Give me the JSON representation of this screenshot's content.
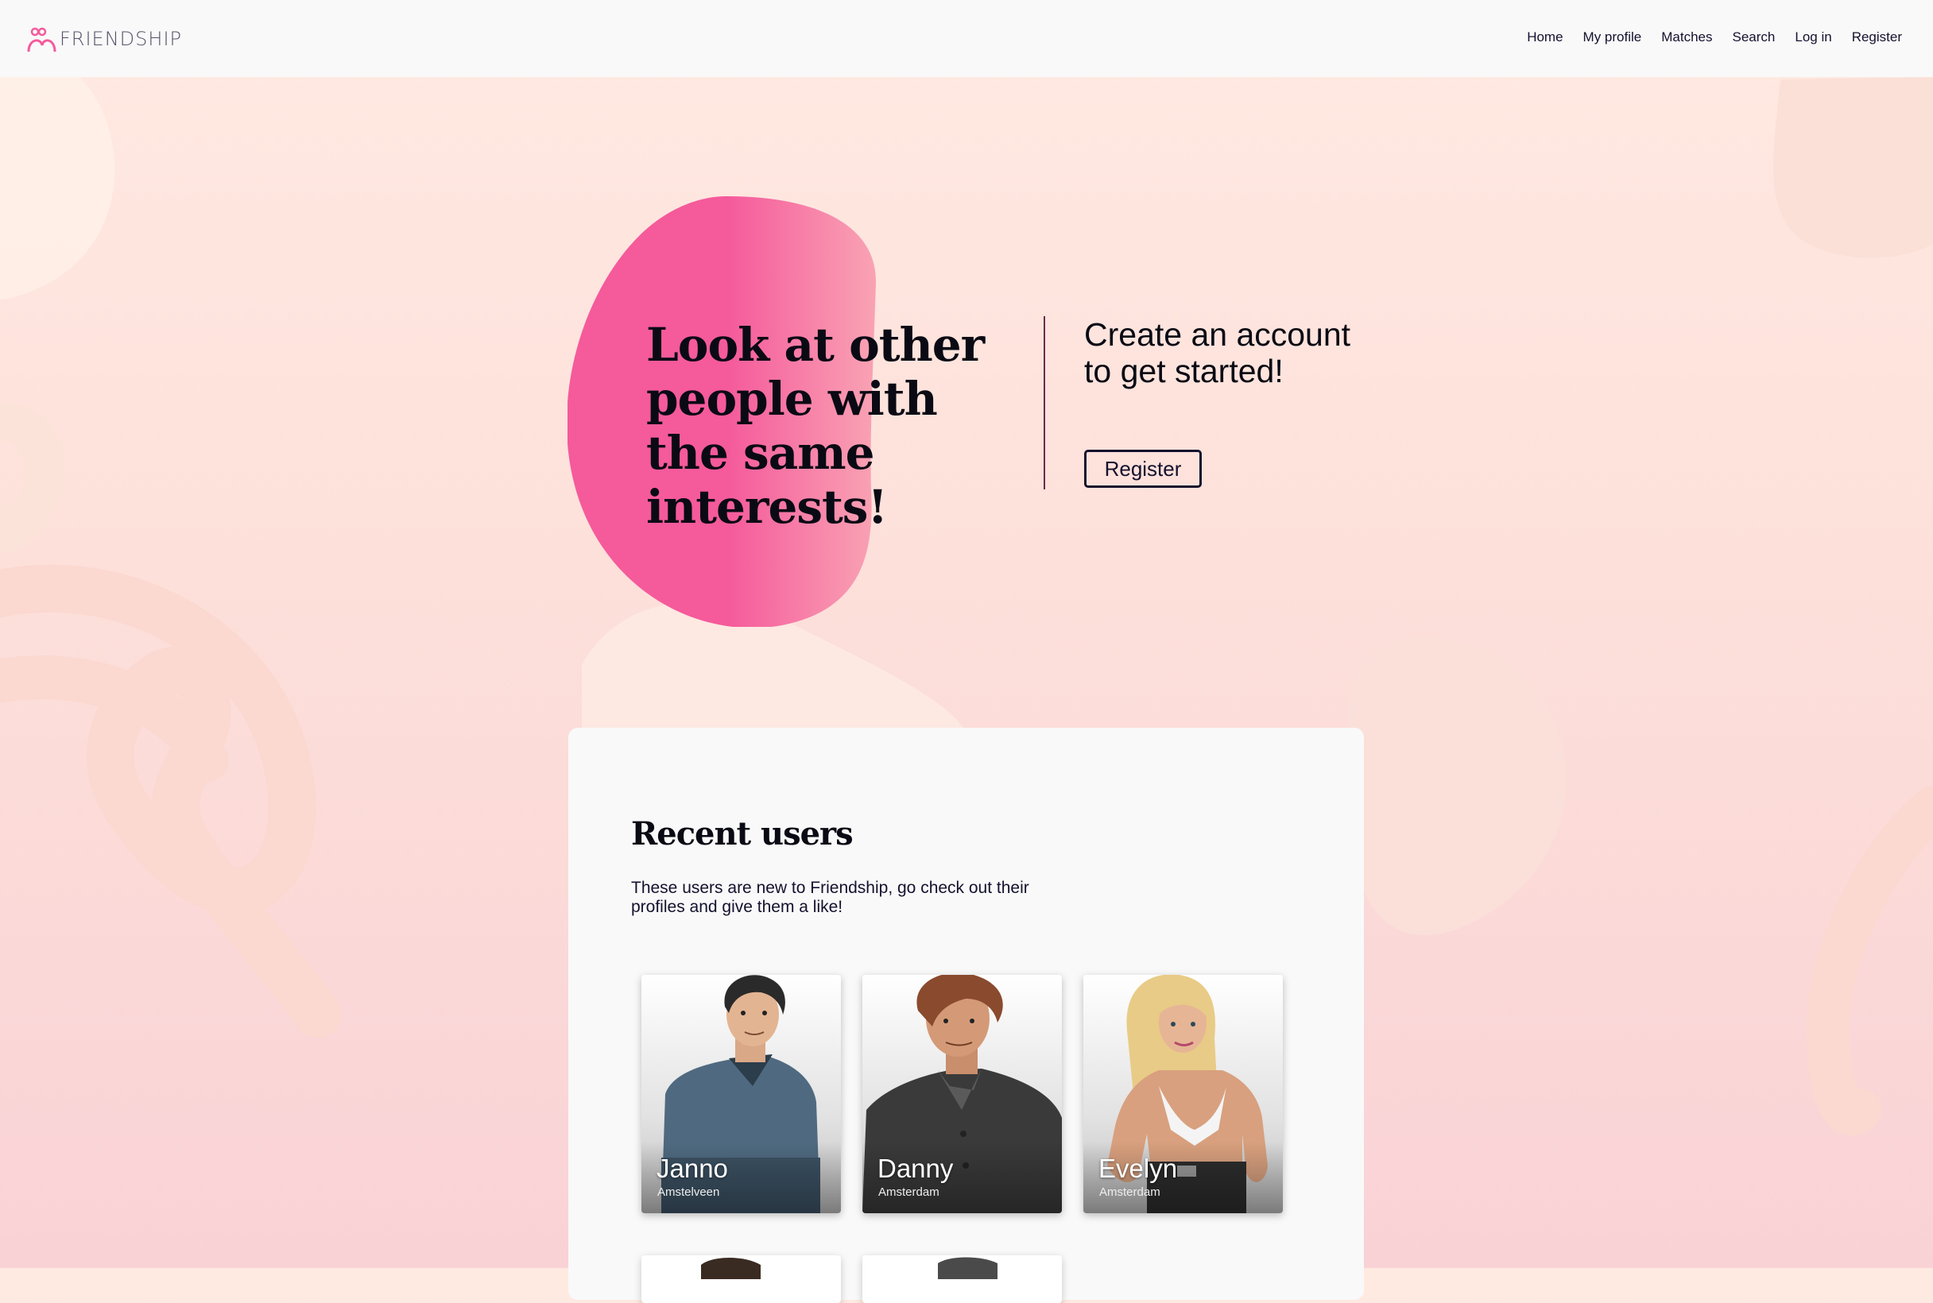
{
  "brand": {
    "name": "FRIENDSHIP",
    "accent": "#f55a9b"
  },
  "nav": {
    "items": [
      "Home",
      "My profile",
      "Matches",
      "Search",
      "Log in",
      "Register"
    ]
  },
  "hero": {
    "title": "Look at other people with the same interests!",
    "cta_text": "Create an account to get started!",
    "cta_button": "Register"
  },
  "recent": {
    "title": "Recent users",
    "description": "These users are new to Friendship, go check out their profiles and give them a like!",
    "users": [
      {
        "name": "Janno",
        "city": "Amstelveen"
      },
      {
        "name": "Danny",
        "city": "Amsterdam"
      },
      {
        "name": "Evelyn",
        "city": "Amsterdam"
      }
    ]
  },
  "colors": {
    "primary_text": "#14112e",
    "navbar_bg": "#f9f9f9",
    "hero_blob": "#f55a9b"
  }
}
